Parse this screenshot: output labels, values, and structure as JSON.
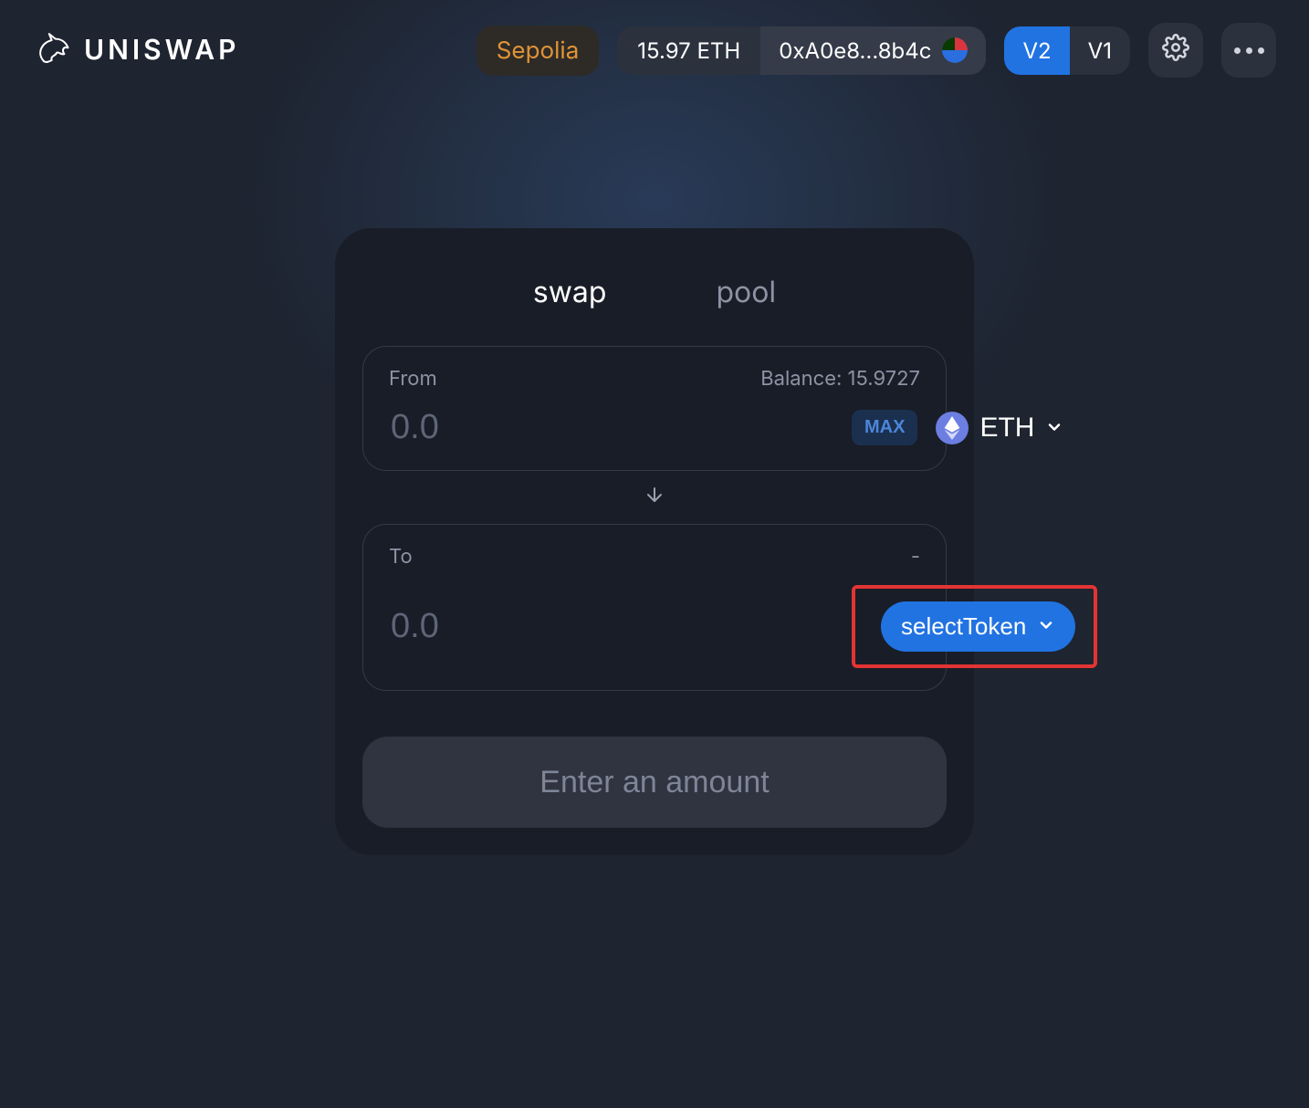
{
  "brand": {
    "name": "UNISWAP"
  },
  "topbar": {
    "network": "Sepolia",
    "balance": "15.97 ETH",
    "address": "0xA0e8...8b4c",
    "versions": {
      "active": "V2",
      "inactive": "V1"
    }
  },
  "tabs": {
    "swap": "swap",
    "pool": "pool"
  },
  "swap": {
    "from": {
      "label": "From",
      "balance_label": "Balance: 15.9727",
      "placeholder": "0.0",
      "max_label": "MAX",
      "token_symbol": "ETH"
    },
    "to": {
      "label": "To",
      "balance_label": "-",
      "placeholder": "0.0",
      "select_label": "selectToken"
    },
    "cta_label": "Enter an amount"
  }
}
